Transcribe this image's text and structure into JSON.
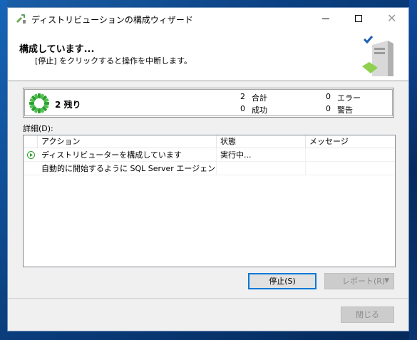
{
  "window": {
    "title": "ディストリビューションの構成ウィザード"
  },
  "header": {
    "title": "構成しています...",
    "subtitle": "[停止] をクリックすると操作を中断します。"
  },
  "progress": {
    "remaining_label": "2 残り",
    "stats": [
      {
        "count": "2",
        "label": "合計"
      },
      {
        "count": "0",
        "label": "成功"
      },
      {
        "count": "0",
        "label": "エラー"
      },
      {
        "count": "0",
        "label": "警告"
      }
    ]
  },
  "details": {
    "label": "詳細(D):",
    "columns": [
      "アクション",
      "状態",
      "メッセージ"
    ],
    "rows": [
      {
        "action": "ディストリビューターを構成しています",
        "status": "実行中...",
        "message": ""
      },
      {
        "action": "自動的に開始するように SQL Server エージェン...",
        "status": "",
        "message": ""
      }
    ]
  },
  "buttons": {
    "stop": "停止(S)",
    "report": "レポート(R)",
    "close": "閉じる"
  },
  "colors": {
    "accent": "#0078d7",
    "progress_green": "#2e9e2e"
  }
}
